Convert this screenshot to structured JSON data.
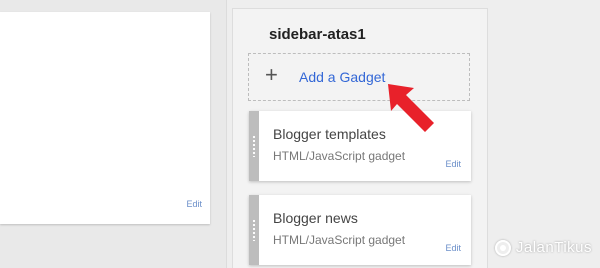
{
  "main": {
    "edit_label": "Edit"
  },
  "sidebar": {
    "title": "sidebar-atas1",
    "add_gadget": {
      "icon": "plus-icon",
      "icon_glyph": "+",
      "label": "Add a Gadget"
    },
    "gadgets": [
      {
        "title": "Blogger templates",
        "type": "HTML/JavaScript gadget",
        "edit_label": "Edit"
      },
      {
        "title": "Blogger news",
        "type": "HTML/JavaScript gadget",
        "edit_label": "Edit"
      }
    ]
  },
  "annotation": {
    "arrow_color": "#e8212a"
  },
  "watermark": {
    "text": "JalanTikus"
  }
}
